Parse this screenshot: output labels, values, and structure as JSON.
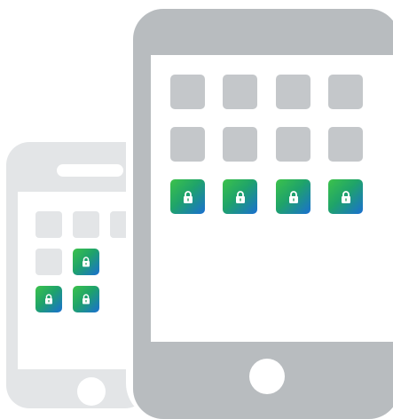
{
  "illustration": {
    "phone": {
      "rows": [
        [
          "plain",
          "plain",
          "plain"
        ],
        [
          "plain",
          "secure"
        ],
        [
          "secure",
          "secure"
        ]
      ]
    },
    "tablet": {
      "rows": [
        [
          "plain",
          "plain",
          "plain",
          "plain"
        ],
        [
          "plain",
          "plain",
          "plain",
          "plain"
        ],
        [
          "secure",
          "secure",
          "secure",
          "secure"
        ]
      ]
    },
    "colors": {
      "tablet_body": "#b8bcbf",
      "phone_body": "#e3e5e7",
      "plain_tile_tablet": "#c4c7ca",
      "plain_tile_phone": "#e3e5e7",
      "secure_tile_gradient": [
        "#3cc24a",
        "#1fa36a",
        "#1a6fd1"
      ],
      "lock_icon": "#ffffff"
    },
    "icons": {
      "secure_tile": "lock-icon"
    }
  }
}
